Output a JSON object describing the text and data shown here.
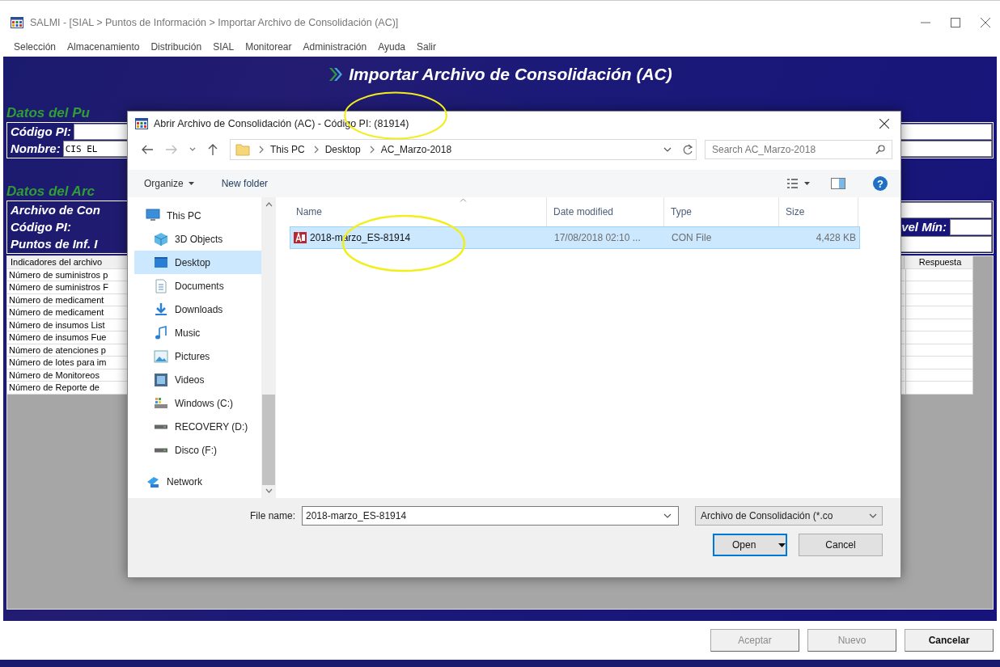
{
  "window": {
    "title": "SALMI - [SIAL > Puntos de Información > Importar Archivo de Consolidación (AC)]"
  },
  "menu": [
    "Selección",
    "Almacenamiento",
    "Distribución",
    "SIAL",
    "Monitorear",
    "Administración",
    "Ayuda",
    "Salir"
  ],
  "page_title": "Importar Archivo de Consolidación (AC)",
  "section_pi": {
    "heading": "Datos del Pu",
    "fields": [
      {
        "label": "Código PI:"
      },
      {
        "label": "Nombre:",
        "value": "CIS EL"
      }
    ]
  },
  "section_archivo": {
    "heading": "Datos del Arc",
    "rows": [
      {
        "label": "Archivo de Con"
      },
      {
        "label": "Código PI:",
        "right_label": "vel Mín:"
      },
      {
        "label": "Puntos de Inf. I"
      }
    ]
  },
  "table": {
    "columns": [
      "Indicadores del archivo",
      "Respuesta"
    ],
    "rows": [
      "Número de suministros p",
      "Número de suministros F",
      "Número de medicament",
      "Número de medicament",
      "Número de insumos List",
      "Número de insumos Fue",
      "Número de atenciones p",
      "Número de lotes para im",
      "Número de Monitoreos",
      "Número de Reporte de"
    ]
  },
  "buttons": [
    {
      "label": "Aceptar",
      "disabled": true
    },
    {
      "label": "Nuevo",
      "disabled": true
    },
    {
      "label": "Cancelar",
      "disabled": false
    }
  ],
  "dialog": {
    "title": "Abrir Archivo de Consolidación (AC) - Código PI: (81914)",
    "back": {
      "disabled": false
    },
    "forward": {
      "disabled": true
    },
    "breadcrumbs": [
      "This PC",
      "Desktop",
      "AC_Marzo-2018"
    ],
    "search": {
      "placeholder": "Search AC_Marzo-2018"
    },
    "toolbar": {
      "organize": "Organize",
      "new_folder": "New folder",
      "help": "?"
    },
    "nav_pane": [
      {
        "label": "This PC",
        "kind": "pc",
        "selected": false,
        "children": [
          {
            "label": "3D Objects",
            "kind": "objects",
            "selected": false
          },
          {
            "label": "Desktop",
            "kind": "desktop",
            "selected": true
          },
          {
            "label": "Documents",
            "kind": "documents",
            "selected": false
          },
          {
            "label": "Downloads",
            "kind": "downloads",
            "selected": false
          },
          {
            "label": "Music",
            "kind": "music",
            "selected": false
          },
          {
            "label": "Pictures",
            "kind": "pictures",
            "selected": false
          },
          {
            "label": "Videos",
            "kind": "videos",
            "selected": false
          },
          {
            "label": "Windows (C:)",
            "kind": "osdrive",
            "selected": false
          },
          {
            "label": "RECOVERY (D:)",
            "kind": "drive",
            "selected": false
          },
          {
            "label": "Disco (F:)",
            "kind": "drive",
            "selected": false
          }
        ]
      },
      {
        "label": "Network",
        "kind": "network",
        "selected": false
      }
    ],
    "columns": [
      "Name",
      "Date modified",
      "Type",
      "Size"
    ],
    "files": [
      {
        "name": "2018-marzo_ES-81914",
        "date": "17/08/2018 02:10 ...",
        "type": "CON File",
        "size": "4,428 KB",
        "selected": true
      }
    ],
    "file_name": {
      "label": "File name:",
      "value": "2018-marzo_ES-81914"
    },
    "filter": "Archivo de Consolidación (*.co",
    "buttons": [
      {
        "label": "Open",
        "kind": "split",
        "default": true
      },
      {
        "label": "Cancel",
        "kind": "plain",
        "default": false
      }
    ]
  }
}
